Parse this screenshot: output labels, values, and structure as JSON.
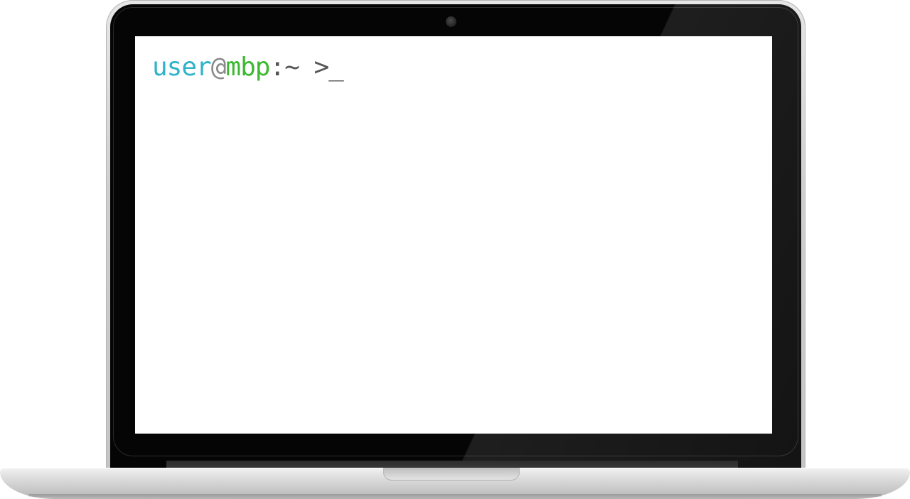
{
  "terminal": {
    "user": "user",
    "at": "@",
    "host": "mbp",
    "path": ":~",
    "cursor": " >_"
  },
  "colors": {
    "user": "#2fb3c8",
    "at": "#8a8a8a",
    "host": "#3cb832",
    "path": "#555555",
    "cursor": "#555555",
    "bezel": "#050505",
    "screen": "#ffffff"
  },
  "icons": {
    "camera": "camera-icon"
  }
}
